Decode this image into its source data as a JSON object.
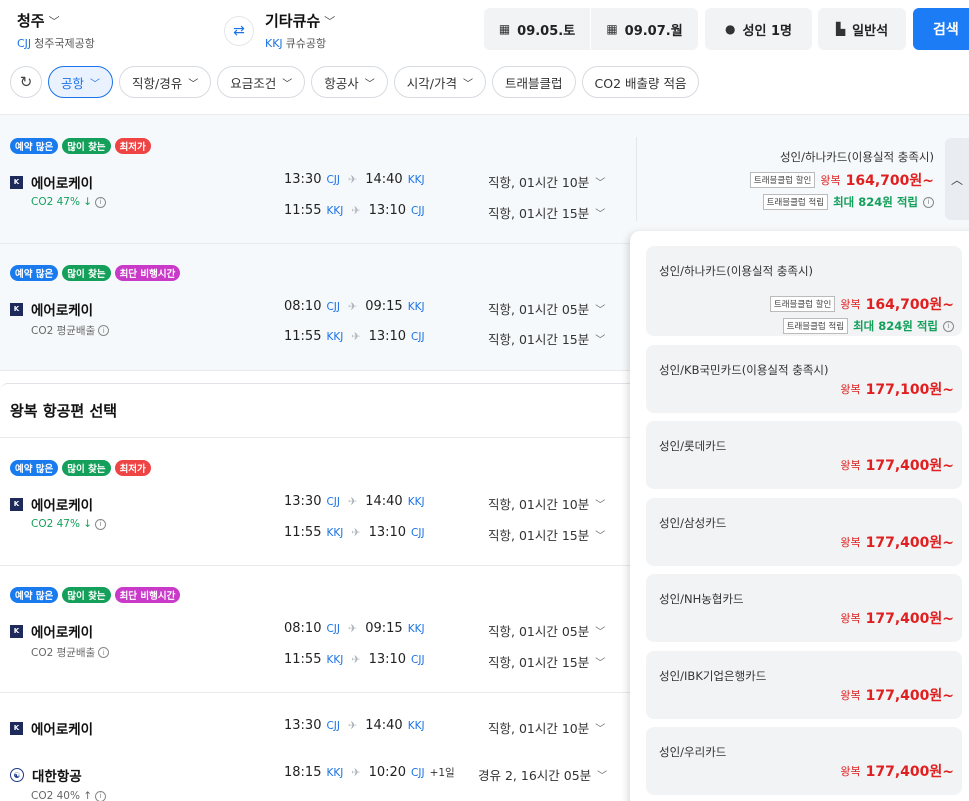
{
  "header": {
    "origin": {
      "city": "청주",
      "code": "CJJ",
      "airport": "청주국제공항"
    },
    "destination": {
      "city": "기타큐슈",
      "code": "KKJ",
      "airport": "큐슈공항"
    },
    "depart_date": "09.05.토",
    "return_date": "09.07.월",
    "passengers": "성인 1명",
    "cabin": "일반석",
    "search_label": "검색"
  },
  "filters": [
    "공항",
    "직항/경유",
    "요금조건",
    "항공사",
    "시각/가격",
    "트래블클럽",
    "CO2 배출량 적음"
  ],
  "icons": {
    "refresh": "refresh-icon",
    "swap": "swap-icon",
    "calendar": "calendar-icon",
    "person": "person-icon",
    "seat": "seat-icon"
  },
  "section_title": "왕복 항공편 선택",
  "flights": [
    {
      "badges": [
        "예약 많은",
        "많이 찾는",
        "최저가"
      ],
      "airline": "에어로케이",
      "co2": "CO2 47% ↓",
      "out": {
        "dep": "13:30",
        "dep_ap": "CJJ",
        "arr": "14:40",
        "arr_ap": "KKJ",
        "dur": "직항, 01시간 10분"
      },
      "ret": {
        "dep": "11:55",
        "dep_ap": "KKJ",
        "arr": "13:10",
        "arr_ap": "CJJ",
        "dur": "직항, 01시간 15분"
      }
    },
    {
      "badges": [
        "예약 많은",
        "많이 찾는",
        "최단 비행시간"
      ],
      "airline": "에어로케이",
      "co2": "CO2 평균배출",
      "out": {
        "dep": "08:10",
        "dep_ap": "CJJ",
        "arr": "09:15",
        "arr_ap": "KKJ",
        "dur": "직항, 01시간 05분"
      },
      "ret": {
        "dep": "11:55",
        "dep_ap": "KKJ",
        "arr": "13:10",
        "arr_ap": "CJJ",
        "dur": "직항, 01시간 15분"
      }
    },
    {
      "badges": [
        "예약 많은",
        "많이 찾는",
        "최저가"
      ],
      "airline": "에어로케이",
      "co2": "CO2 47% ↓",
      "out": {
        "dep": "13:30",
        "dep_ap": "CJJ",
        "arr": "14:40",
        "arr_ap": "KKJ",
        "dur": "직항, 01시간 10분"
      },
      "ret": {
        "dep": "11:55",
        "dep_ap": "KKJ",
        "arr": "13:10",
        "arr_ap": "CJJ",
        "dur": "직항, 01시간 15분"
      }
    },
    {
      "badges": [
        "예약 많은",
        "많이 찾는",
        "최단 비행시간"
      ],
      "airline": "에어로케이",
      "co2": "CO2 평균배출",
      "out": {
        "dep": "08:10",
        "dep_ap": "CJJ",
        "arr": "09:15",
        "arr_ap": "KKJ",
        "dur": "직항, 01시간 05분"
      },
      "ret": {
        "dep": "11:55",
        "dep_ap": "KKJ",
        "arr": "13:10",
        "arr_ap": "CJJ",
        "dur": "직항, 01시간 15분"
      }
    },
    {
      "airline": "에어로케이",
      "airline2": "대한항공",
      "co2": "CO2 40% ↑",
      "out": {
        "dep": "13:30",
        "dep_ap": "CJJ",
        "arr": "14:40",
        "arr_ap": "KKJ",
        "dur": "직항, 01시간 10분"
      },
      "ret": {
        "dep": "18:15",
        "dep_ap": "KKJ",
        "arr": "10:20",
        "arr_ap": "CJJ",
        "plus": "+1일",
        "dur": "경유 2, 16시간 05분"
      }
    }
  ],
  "top_price": {
    "title": "성인/하나카드(이용실적 충족시)",
    "discount_tag": "트래블클럽 할인",
    "roundtrip": "왕복",
    "amount": "164,700원~",
    "points_tag": "트래블클럽 적립",
    "points": "최대 824원 적립"
  },
  "price_options": [
    {
      "name": "성인/하나카드(이용실적 충족시)",
      "discount_tag": "트래블클럽 할인",
      "roundtrip": "왕복",
      "amount": "164,700원~",
      "points_tag": "트래블클럽 적립",
      "points": "최대 824원 적립"
    },
    {
      "name": "성인/KB국민카드(이용실적 충족시)",
      "roundtrip": "왕복",
      "amount": "177,100원~"
    },
    {
      "name": "성인/롯데카드",
      "roundtrip": "왕복",
      "amount": "177,400원~"
    },
    {
      "name": "성인/삼성카드",
      "roundtrip": "왕복",
      "amount": "177,400원~"
    },
    {
      "name": "성인/NH농협카드",
      "roundtrip": "왕복",
      "amount": "177,400원~"
    },
    {
      "name": "성인/IBK기업은행카드",
      "roundtrip": "왕복",
      "amount": "177,400원~"
    },
    {
      "name": "성인/우리카드",
      "roundtrip": "왕복",
      "amount": "177,400원~"
    }
  ],
  "colors": {
    "accent": "#1a73e8",
    "search": "#1b7cf5",
    "price": "#e02020",
    "points": "#14a05a"
  }
}
